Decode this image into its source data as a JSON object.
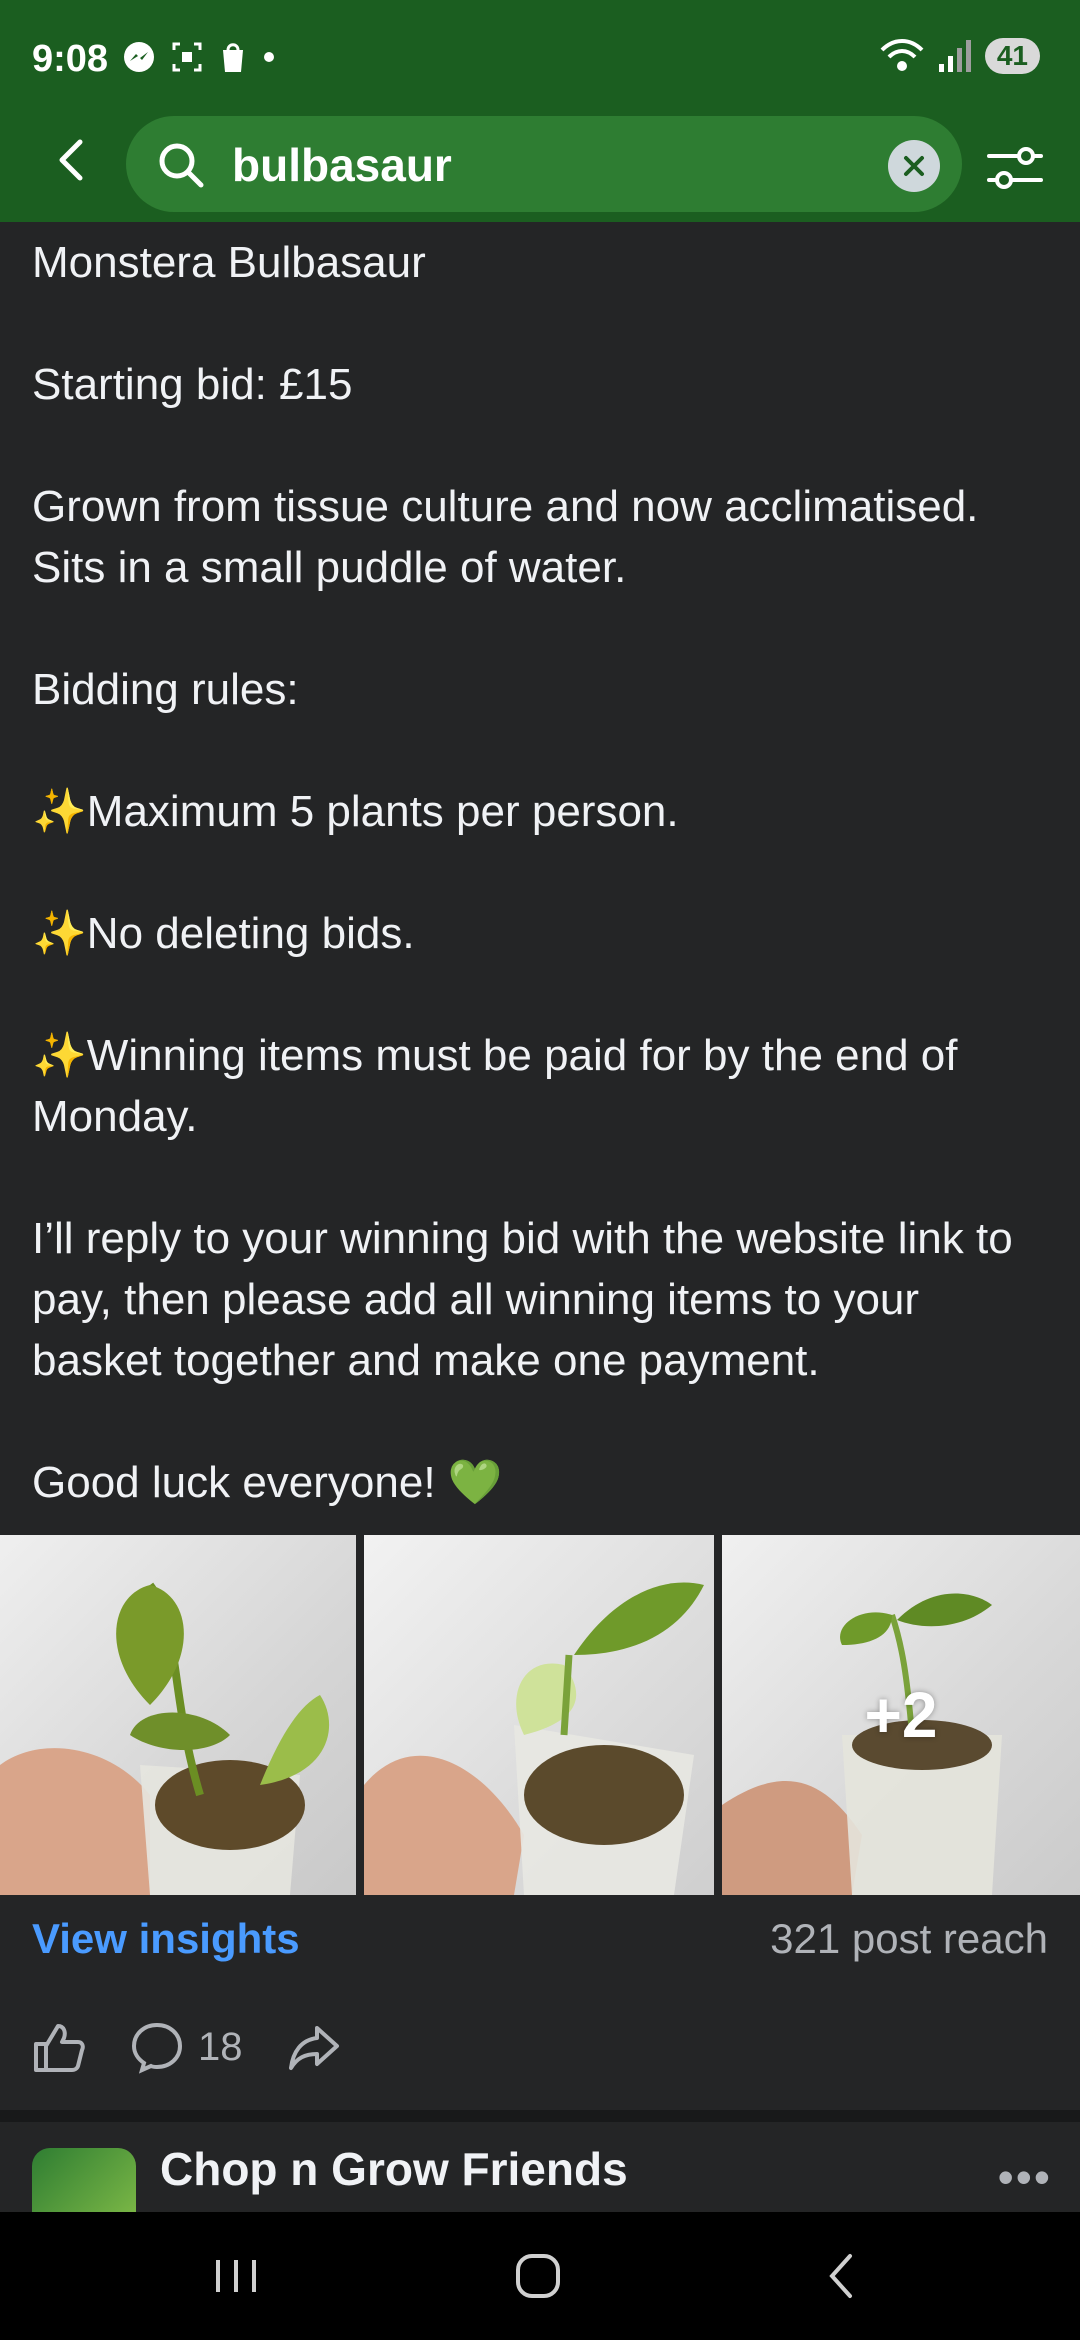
{
  "status_bar": {
    "time": "9:08",
    "battery": "41",
    "left_icons": [
      "messenger-icon",
      "screenshot-icon",
      "shopify-icon",
      "dot-icon"
    ],
    "right_icons": [
      "wifi-icon",
      "signal-icon",
      "battery-icon"
    ]
  },
  "search": {
    "query": "bulbasaur",
    "icons": [
      "back-arrow-icon",
      "search-icon",
      "clear-icon",
      "filter-icon"
    ]
  },
  "post": {
    "lines": [
      "Monstera Bulbasaur",
      "Starting bid: £15",
      "Grown from tissue culture and now acclimatised. Sits in a small puddle of water.",
      "Bidding rules:",
      "Maximum 5 plants per person.",
      "No deleting bids.",
      "Winning items must be paid for by the end of Monday.",
      "I’ll reply to your winning bid with the website link to pay, then please add all winning items to your basket together and make one payment.",
      "Good luck everyone!"
    ],
    "sparkle": "✨",
    "heart": "💚",
    "photos_more": "+2",
    "view_insights": "View insights",
    "reach": "321 post reach",
    "comments_count": "18"
  },
  "next_post": {
    "group_name": "Chop n Grow Friends",
    "more": "•••"
  },
  "colors": {
    "header_green": "#1b5e20",
    "search_pill": "#2e7d32",
    "background": "#242526",
    "link_blue": "#4a9bff"
  }
}
